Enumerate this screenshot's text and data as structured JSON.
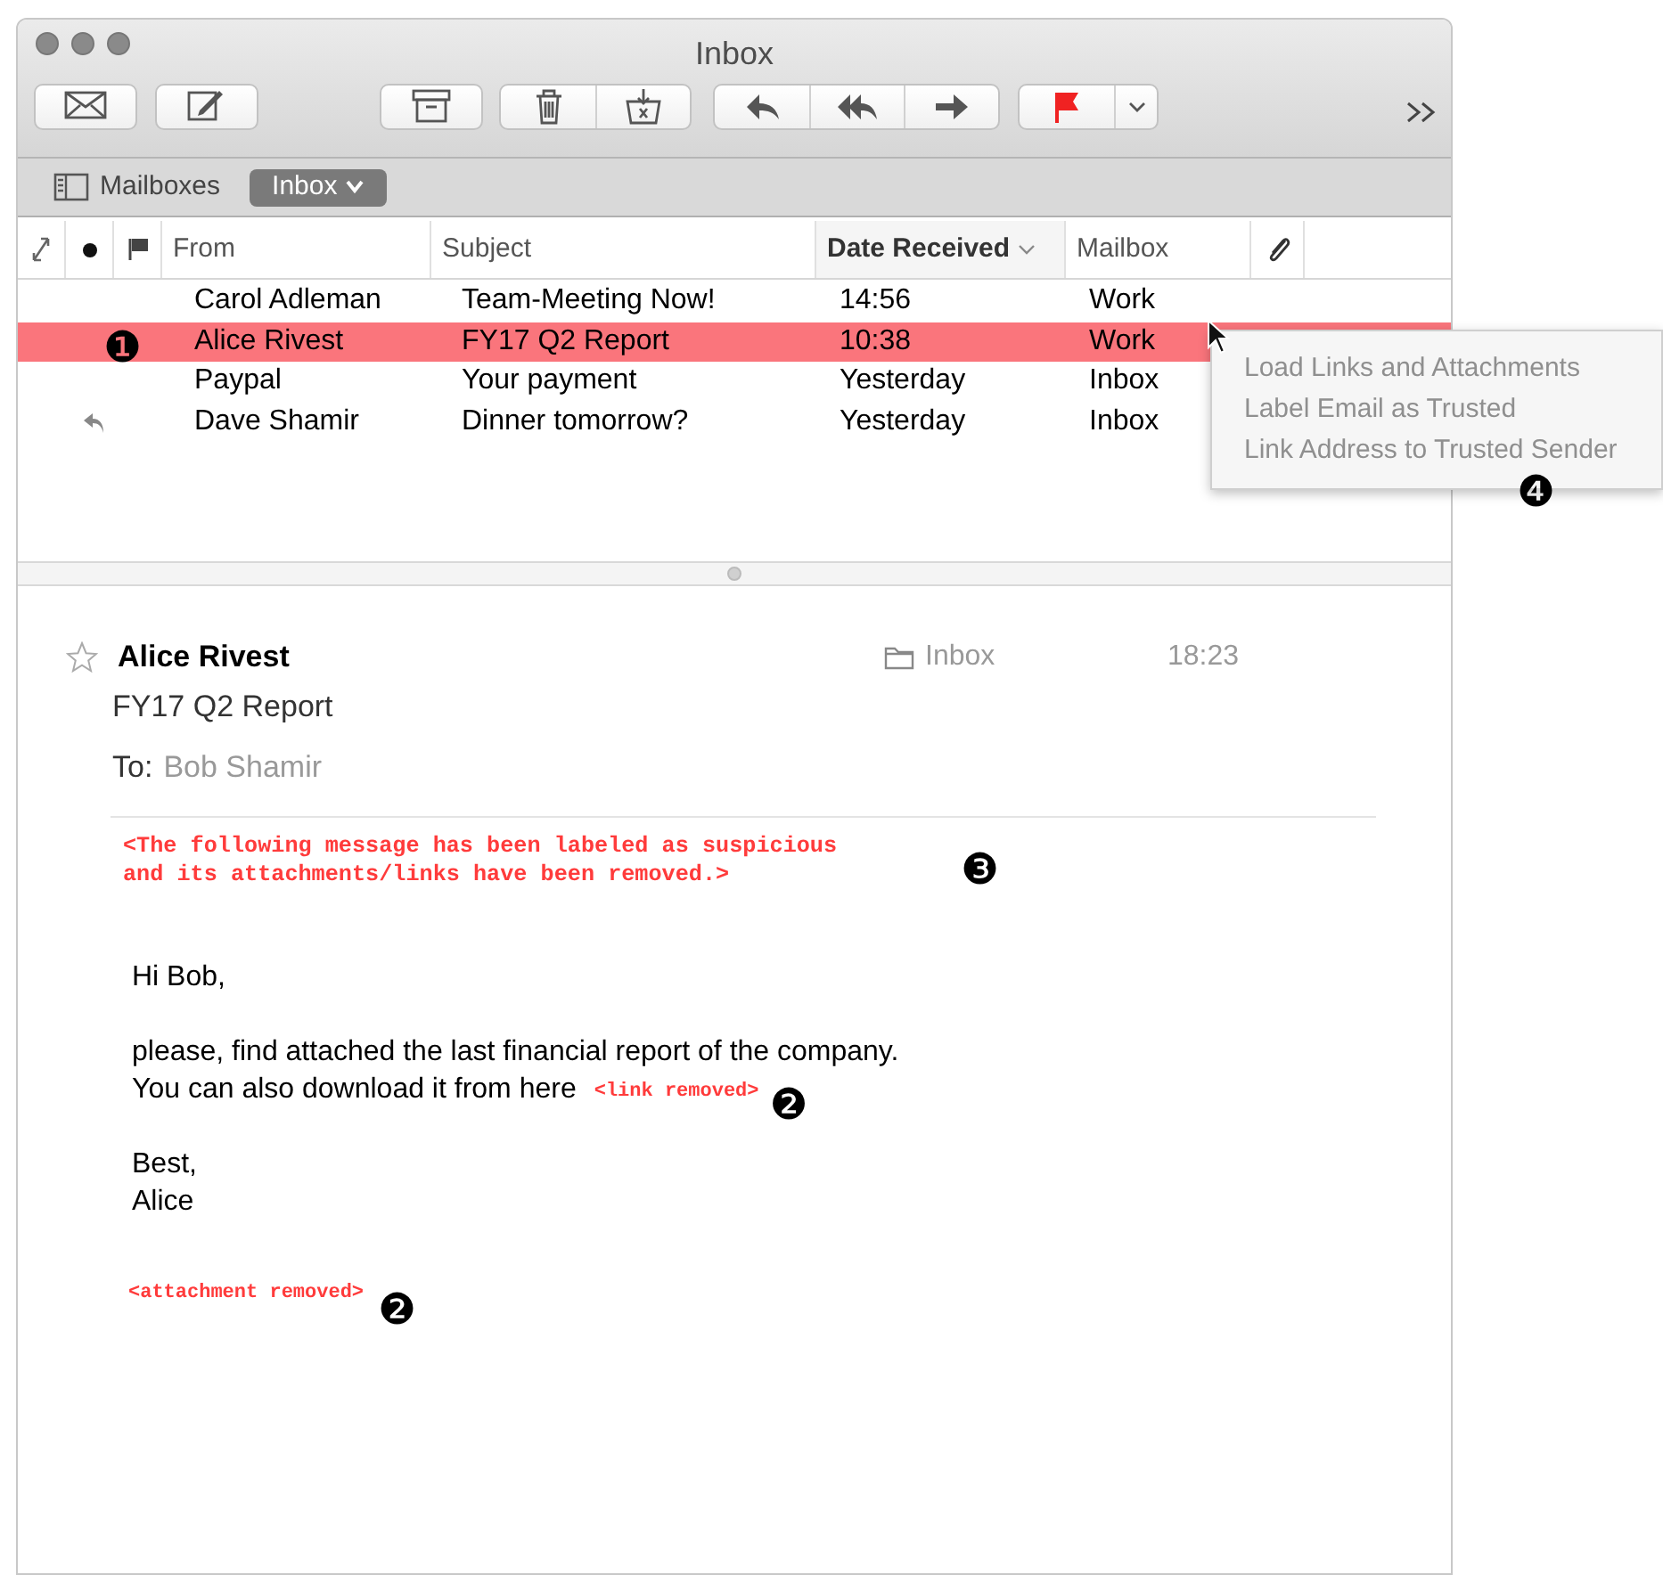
{
  "window": {
    "title": "Inbox"
  },
  "mailbox_bar": {
    "mailboxes_label": "Mailboxes",
    "inbox_button": "Inbox"
  },
  "columns": [
    {
      "label": "From",
      "sorted": false
    },
    {
      "label": "Subject",
      "sorted": false
    },
    {
      "label": "Date Received",
      "sorted": true
    },
    {
      "label": "Mailbox",
      "sorted": false
    }
  ],
  "rows": [
    {
      "from": "Carol Adleman",
      "subject": "Team-Meeting Now!",
      "date": "14:56",
      "mailbox": "Work",
      "selected": false,
      "replied": false
    },
    {
      "from": "Alice Rivest",
      "subject": "FY17 Q2 Report",
      "date": "10:38",
      "mailbox": "Work",
      "selected": true,
      "replied": false,
      "callout": "❶"
    },
    {
      "from": "Paypal",
      "subject": "Your payment",
      "date": "Yesterday",
      "mailbox": "Inbox",
      "selected": false,
      "replied": false
    },
    {
      "from": "Dave Shamir",
      "subject": "Dinner tomorrow?",
      "date": "Yesterday",
      "mailbox": "Inbox",
      "selected": false,
      "replied": true
    }
  ],
  "context_menu": {
    "items": [
      {
        "label": "Load Links and Attachments",
        "disabled": true
      },
      {
        "label": "Label Email as Trusted",
        "disabled": true
      },
      {
        "label": "Link Address to Trusted Sender",
        "disabled": true
      }
    ],
    "callout": "❹"
  },
  "message": {
    "sender": "Alice Rivest",
    "mailbox": "Inbox",
    "time": "18:23",
    "subject": "FY17 Q2 Report",
    "to_label": "To:",
    "to": "Bob Shamir",
    "warning": {
      "lines": [
        "<The following message has been labeled as suspicious",
        "and its attachments/links have been removed.>"
      ],
      "callout": "❸"
    },
    "paragraphs": [
      {
        "lines": [
          {
            "text": "Hi Bob,"
          }
        ]
      },
      {
        "lines": [
          {
            "text": "please, find attached the last financial report of the company."
          },
          {
            "text": "You can also download it from here",
            "tag": "<link removed>",
            "callout": "❷"
          }
        ]
      },
      {
        "lines": [
          {
            "text": "Best,"
          },
          {
            "text": "Alice"
          }
        ]
      }
    ],
    "attachment": {
      "tag": "<attachment removed>",
      "callout": "❷"
    }
  }
}
